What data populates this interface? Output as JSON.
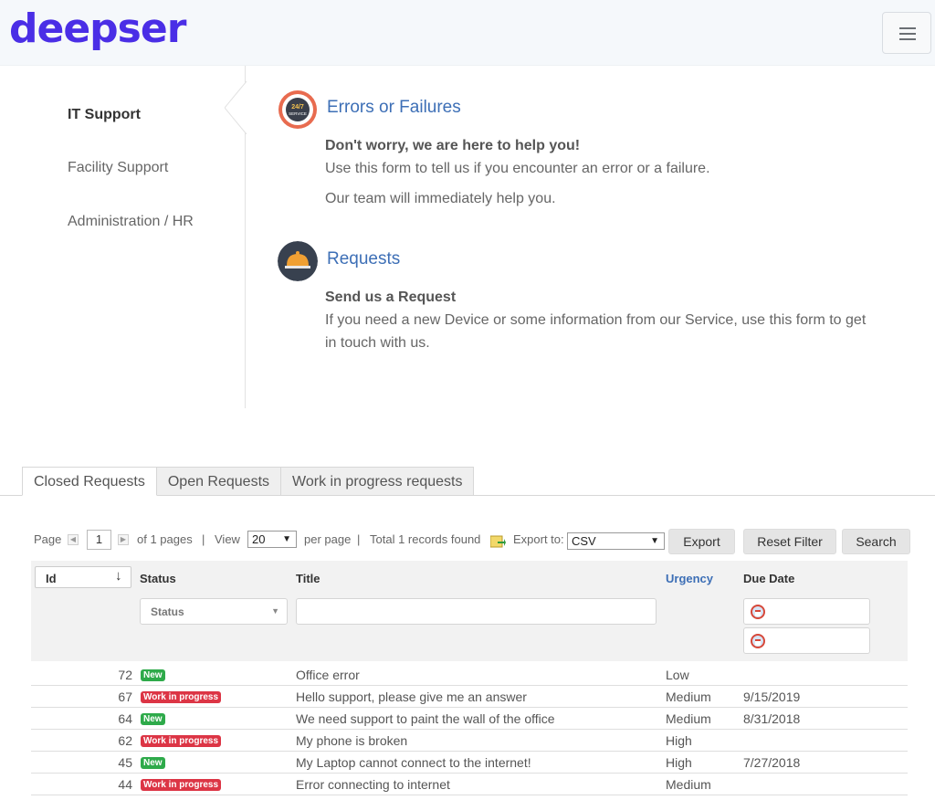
{
  "brand": {
    "logo_text": "deepser"
  },
  "header": {
    "menu_icon": "hamburger-icon"
  },
  "sidebar": {
    "items": [
      {
        "label": "IT Support",
        "active": true
      },
      {
        "label": "Facility Support",
        "active": false
      },
      {
        "label": "Administration / HR",
        "active": false
      }
    ]
  },
  "services": [
    {
      "icon": "service-24-7-icon",
      "icon_text": "24/7 SERVICE",
      "title": "Errors or Failures",
      "subtitle": "Don't worry, we are here to help you!",
      "lines": [
        "Use this form to tell us if you encounter an error or a failure.",
        "Our team will immediately help you."
      ]
    },
    {
      "icon": "service-bell-icon",
      "title": "Requests",
      "subtitle": "Send us a Request",
      "lines": [
        "If you need a new Device or some information from our Service, use this form to get in touch with us."
      ]
    }
  ],
  "tabs": [
    {
      "label": "Closed Requests",
      "active": true
    },
    {
      "label": "Open Requests",
      "active": false
    },
    {
      "label": "Work in progress requests",
      "active": false
    }
  ],
  "pager": {
    "page_label": "Page",
    "page_value": "1",
    "of_pages": "of 1 pages",
    "sep1": "|",
    "view_label": "View",
    "view_value": "20",
    "per_page": "per page",
    "sep2": "|",
    "total": "Total 1 records found",
    "export_label": "Export to:",
    "export_value": "CSV",
    "export_button": "Export",
    "reset_button": "Reset Filter",
    "search_button": "Search"
  },
  "grid": {
    "columns": {
      "id": "Id",
      "status": "Status",
      "title": "Title",
      "urgency": "Urgency",
      "due_date": "Due Date"
    },
    "status_filter_placeholder": "Status",
    "rows": [
      {
        "id": "72",
        "status": "New",
        "title": "Office error",
        "urgency": "Low",
        "due": ""
      },
      {
        "id": "67",
        "status": "Work in progress",
        "title": "Hello support, please give me an answer",
        "urgency": "Medium",
        "due": "9/15/2019"
      },
      {
        "id": "64",
        "status": "New",
        "title": "We need support to paint the wall of the office",
        "urgency": "Medium",
        "due": "8/31/2018"
      },
      {
        "id": "62",
        "status": "Work in progress",
        "title": "My phone is broken",
        "urgency": "High",
        "due": ""
      },
      {
        "id": "45",
        "status": "New",
        "title": "My Laptop cannot connect to the internet!",
        "urgency": "High",
        "due": "7/27/2018"
      },
      {
        "id": "44",
        "status": "Work in progress",
        "title": "Error connecting to internet",
        "urgency": "Medium",
        "due": ""
      }
    ]
  },
  "colors": {
    "brand": "#4a2ee6",
    "link": "#3d6fb6",
    "badge_new": "#2eaa4a",
    "badge_wip": "#dc3545"
  }
}
